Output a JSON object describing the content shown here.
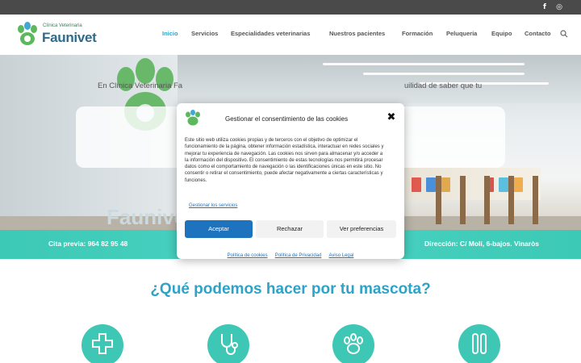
{
  "colors": {
    "accent": "#2ea3c7",
    "teal": "#3ec7b5",
    "topbar": "#4a4a4a",
    "cookie_primary": "#1e73be"
  },
  "topbar": {
    "social": [
      {
        "icon": "facebook-icon",
        "glyph": "f"
      },
      {
        "icon": "instagram-icon",
        "glyph": "◎"
      }
    ]
  },
  "logo": {
    "subtitle": "Clínica Veterinaria",
    "name": "Faunivet"
  },
  "nav": {
    "items": [
      {
        "label": "Inicio",
        "active": true
      },
      {
        "label": "Servicios",
        "active": false
      },
      {
        "label": "Especialidades veterinarias",
        "active": false
      },
      {
        "label": "Nuestros pacientes",
        "active": false
      },
      {
        "label": "Formación",
        "active": false
      },
      {
        "label": "Peluquería",
        "active": false
      },
      {
        "label": "Equipo",
        "active": false
      },
      {
        "label": "Contacto",
        "active": false
      }
    ],
    "search_icon": "search-icon"
  },
  "hero": {
    "wall_brand": "Faunivet",
    "text_left": "En Clínica Veterinaria Fa",
    "text_right": "uilidad de saber que tu"
  },
  "band": {
    "phone": "Cita previa: 964 82 95 48",
    "address": "Dirección: C/ Molí, 6-bajos. Vinaròs"
  },
  "main": {
    "title": "¿Qué podemos hacer por tu mascota?",
    "service_icons": [
      "medical-cross-icon",
      "stethoscope-icon",
      "paw-icon",
      "test-tubes-icon"
    ]
  },
  "cookie": {
    "title": "Gestionar el consentimiento de las cookies",
    "close_glyph": "✖",
    "body": "Este sitio web utiliza cookies propias y de terceros con el objetivo de optimizar el funcionamiento de la página, obtener información estadística, interactuar en redes sociales y mejorar tu experiencia de navegación. Las cookies nos sirven para almacenar y/o acceder a la información del dispositivo. El consentimiento de estas tecnologías nos permitirá procesar datos como el comportamiento de navegación o las identificaciones únicas en este sitio. No consentir o retirar el consentimiento, puede afectar negativamente a ciertas características y funciones.",
    "manage_link": "Gestionar los servicios",
    "accept": "Aceptar",
    "reject": "Rechazar",
    "preferences": "Ver preferencias",
    "links": [
      "Política de cookies",
      "Política de Privacidad",
      "Aviso Legal"
    ]
  }
}
